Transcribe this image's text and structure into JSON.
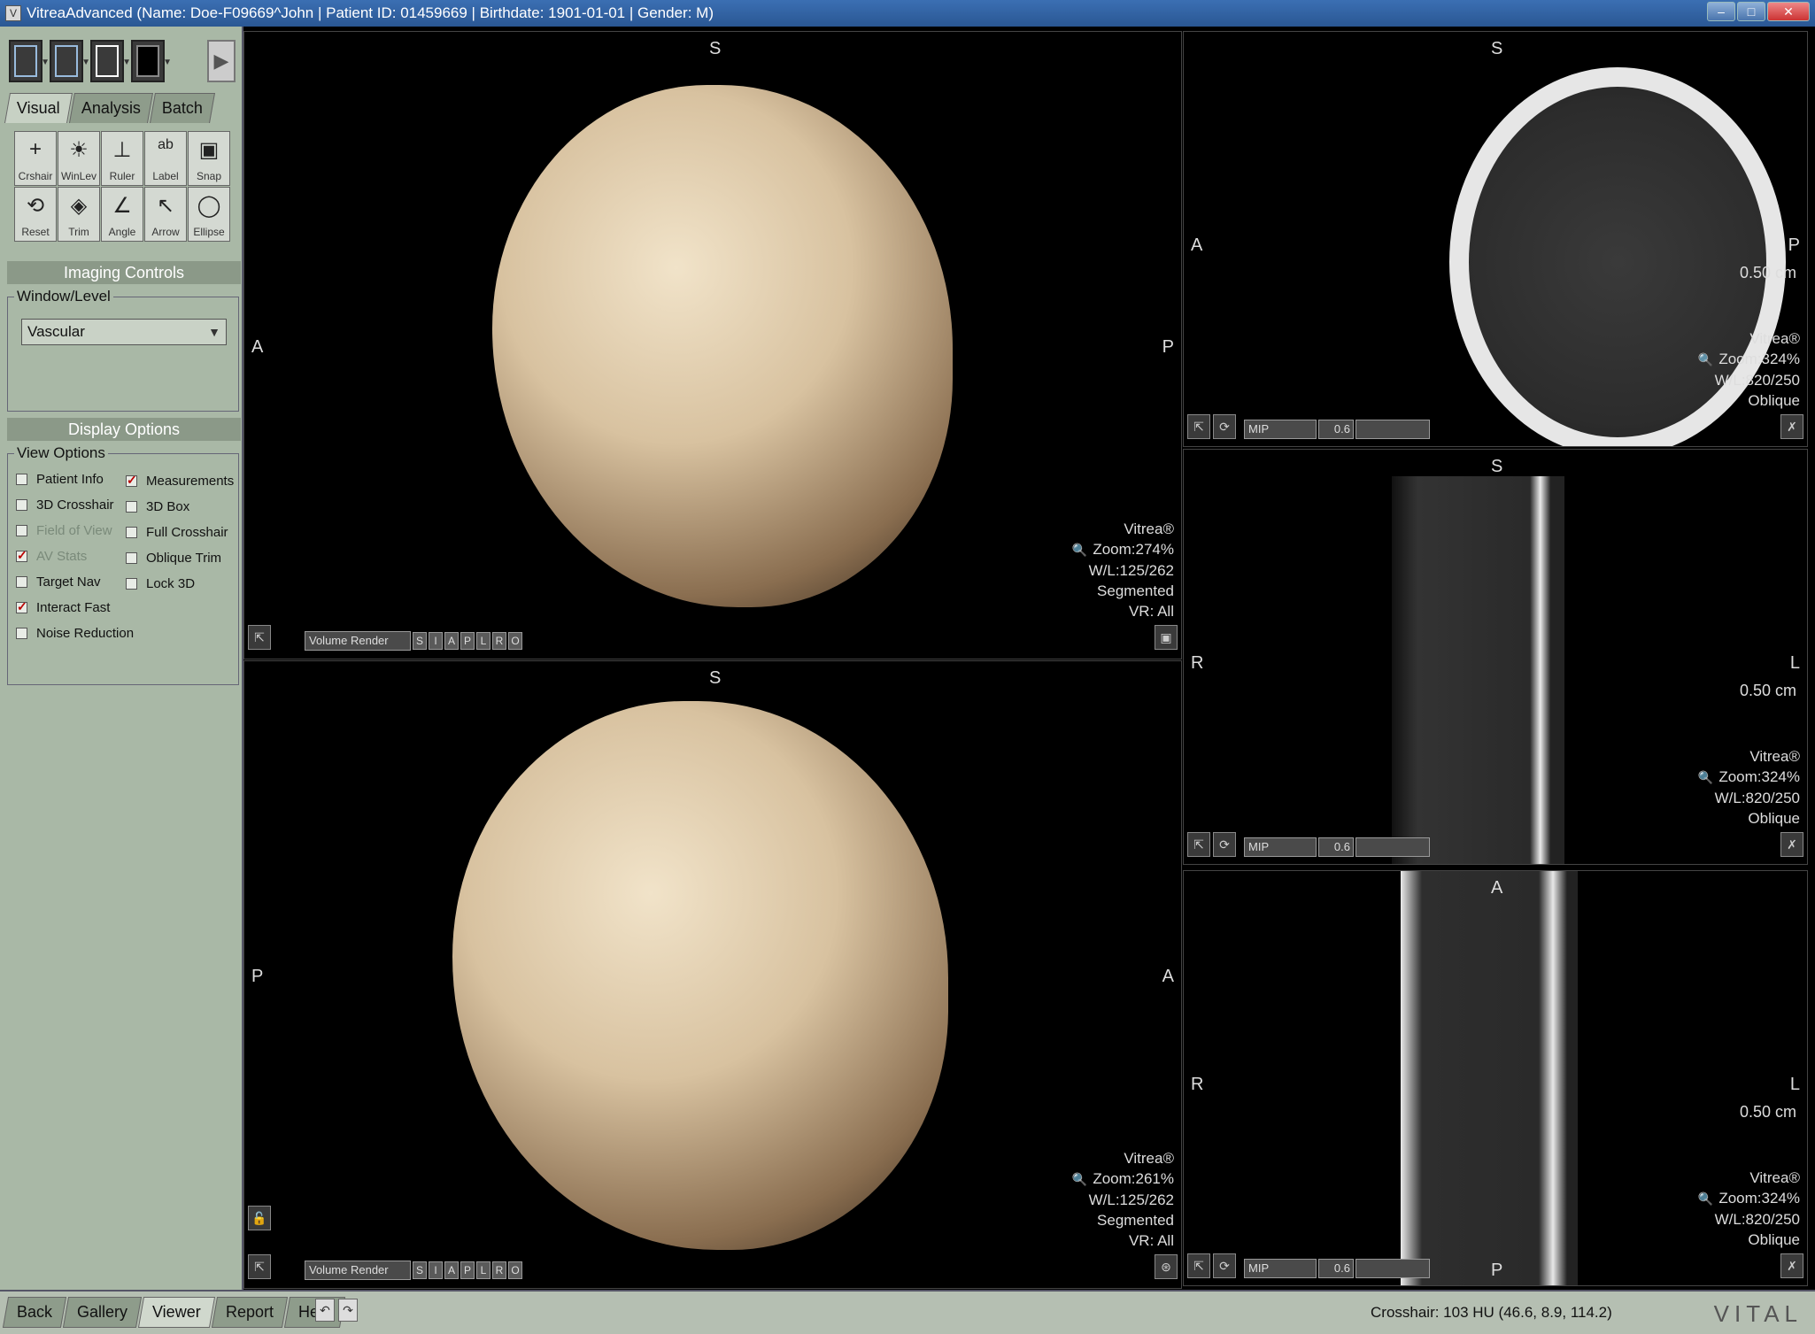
{
  "window": {
    "title": "VitreaAdvanced (Name: Doe-F09669^John | Patient ID: 01459669 | Birthdate: 1901-01-01 | Gender: M)"
  },
  "left": {
    "tabs": [
      "Visual",
      "Analysis",
      "Batch"
    ],
    "tools": [
      "Crshair",
      "WinLev",
      "Ruler",
      "Label",
      "Snap",
      "Reset",
      "Trim",
      "Angle",
      "Arrow",
      "Ellipse"
    ],
    "imaging_controls": "Imaging Controls",
    "window_level_label": "Window/Level",
    "window_level_value": "Vascular",
    "display_options": "Display Options",
    "view_options_label": "View Options",
    "options_left": [
      {
        "label": "Patient Info",
        "checked": false,
        "disabled": false
      },
      {
        "label": "3D Crosshair",
        "checked": false,
        "disabled": false
      },
      {
        "label": "Field of View",
        "checked": false,
        "disabled": true
      },
      {
        "label": "AV Stats",
        "checked": true,
        "disabled": true
      },
      {
        "label": "Target Nav",
        "checked": false,
        "disabled": false
      },
      {
        "label": "Interact Fast",
        "checked": true,
        "disabled": false
      },
      {
        "label": "Noise Reduction",
        "checked": false,
        "disabled": false
      }
    ],
    "options_right": [
      {
        "label": "Measurements",
        "checked": true
      },
      {
        "label": "3D Box",
        "checked": false
      },
      {
        "label": "Full Crosshair",
        "checked": false
      },
      {
        "label": "Oblique Trim",
        "checked": false
      },
      {
        "label": "Lock 3D",
        "checked": false
      }
    ]
  },
  "vp3d_top": {
    "orient_top": "S",
    "orient_left": "A",
    "orient_right": "P",
    "brand": "Vitrea®",
    "zoom": "Zoom:274%",
    "wl": "W/L:125/262",
    "mode": "Segmented",
    "vr": "VR: All",
    "render": "Volume Render",
    "views": [
      "S",
      "I",
      "A",
      "P",
      "L",
      "R",
      "O"
    ]
  },
  "vp3d_bottom": {
    "orient_top": "S",
    "orient_left": "P",
    "orient_right": "A",
    "brand": "Vitrea®",
    "zoom": "Zoom:261%",
    "wl": "W/L:125/262",
    "mode": "Segmented",
    "vr": "VR: All",
    "render": "Volume Render",
    "views": [
      "S",
      "I",
      "A",
      "P",
      "L",
      "R",
      "O"
    ]
  },
  "mpr1": {
    "orient_top": "S",
    "orient_left": "A",
    "orient_right": "P",
    "scale": "0.50 cm",
    "brand": "Vitrea®",
    "zoom": "Zoom:324%",
    "wl": "W/L:820/250",
    "plane": "Oblique",
    "mode": "MIP",
    "thickness": "0.6"
  },
  "mpr2": {
    "orient_top": "S",
    "orient_left": "R",
    "orient_right": "L",
    "scale": "0.50 cm",
    "brand": "Vitrea®",
    "zoom": "Zoom:324%",
    "wl": "W/L:820/250",
    "plane": "Oblique",
    "mode": "MIP",
    "thickness": "0.6"
  },
  "mpr3": {
    "orient_top": "A",
    "orient_left": "R",
    "orient_right": "L",
    "orient_bottom": "P",
    "scale": "0.50 cm",
    "brand": "Vitrea®",
    "zoom": "Zoom:324%",
    "wl": "W/L:820/250",
    "plane": "Oblique",
    "mode": "MIP",
    "thickness": "0.6"
  },
  "bottom": {
    "tabs": [
      "Back",
      "Gallery",
      "Viewer",
      "Report",
      "Help"
    ],
    "crosshair": "Crosshair: 103 HU (46.6, 8.9, 114.2)",
    "brand": "VITAL"
  }
}
